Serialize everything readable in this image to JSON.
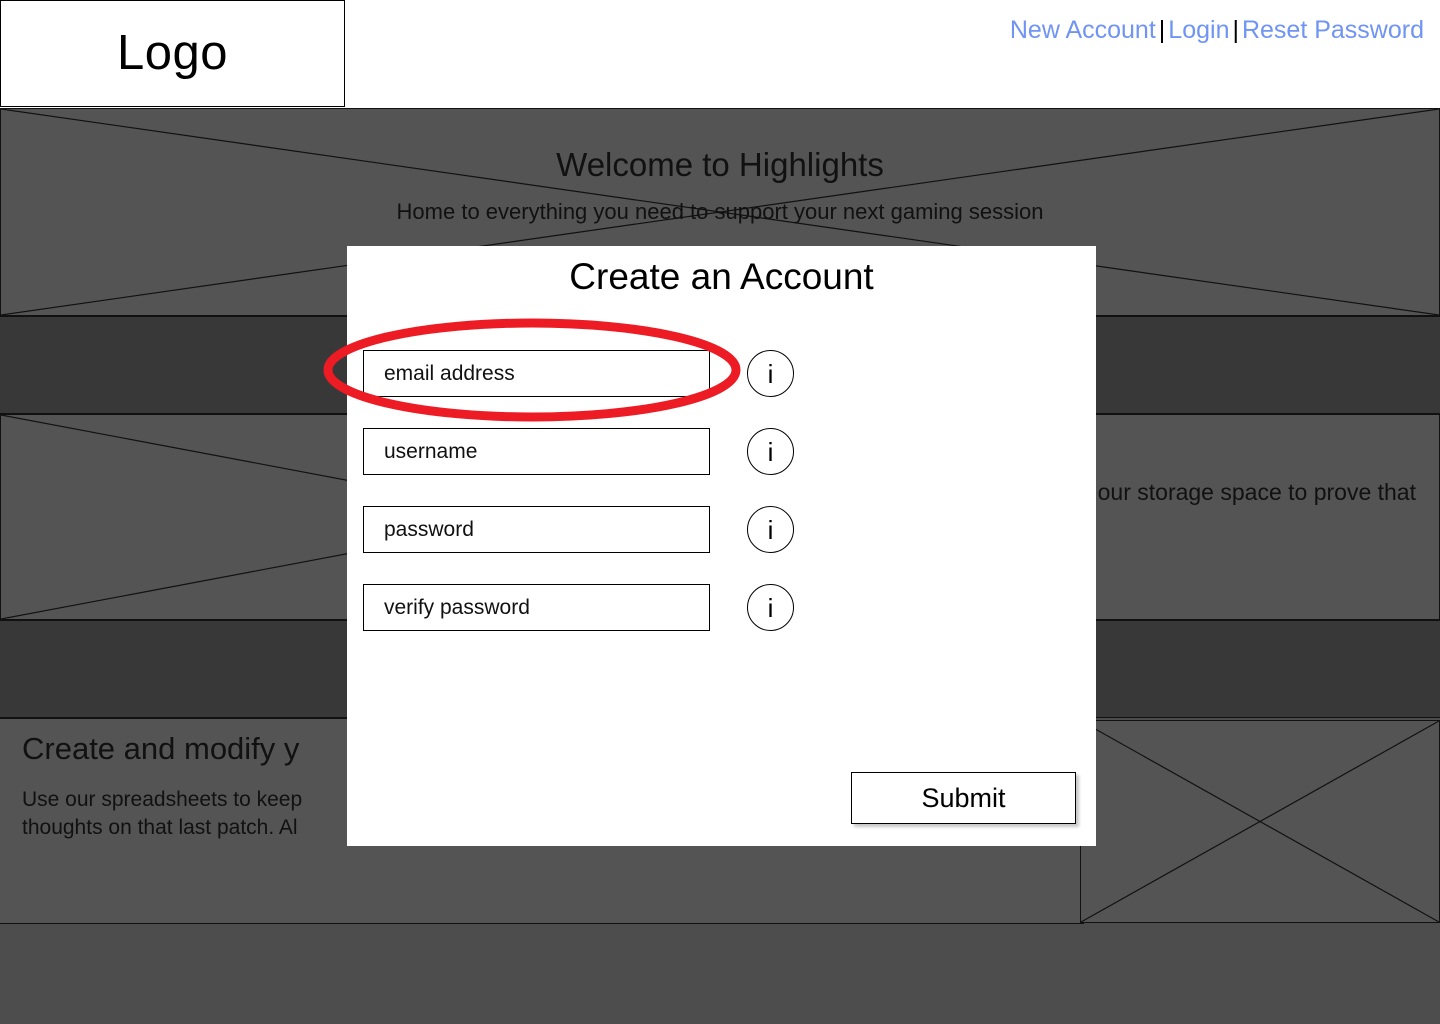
{
  "header": {
    "logo_label": "Logo",
    "nav": [
      {
        "label": "New Account"
      },
      {
        "label": "Login"
      },
      {
        "label": "Reset Password"
      }
    ],
    "nav_separator": "|"
  },
  "hero": {
    "title": "Welcome to Highlights",
    "subtitle": "Home to everything you need to support your next gaming session"
  },
  "sections": {
    "middle_text": "our storage space to prove that",
    "feature_heading": "Create and modify y",
    "feature_body": "Use our spreadsheets to keep\nthoughts on that last patch. Al"
  },
  "modal": {
    "title": "Create an Account",
    "fields": [
      {
        "placeholder": "email address",
        "value": "",
        "info_glyph": "i",
        "highlighted": true
      },
      {
        "placeholder": "username",
        "value": "",
        "info_glyph": "i",
        "highlighted": false
      },
      {
        "placeholder": "password",
        "value": "",
        "info_glyph": "i",
        "highlighted": false
      },
      {
        "placeholder": "verify password",
        "value": "",
        "info_glyph": "i",
        "highlighted": false
      }
    ],
    "submit_label": "Submit"
  },
  "annotation": {
    "shape": "ellipse",
    "target": "email address field",
    "color": "#ED1C24",
    "stroke_width": 9
  },
  "colors": {
    "link": "#6f94f3",
    "page_background": "#4d4d4d",
    "band_dark": "#383838",
    "panel_gray": "#545454",
    "modal_background": "#ffffff",
    "annotation_red": "#ED1C24"
  }
}
